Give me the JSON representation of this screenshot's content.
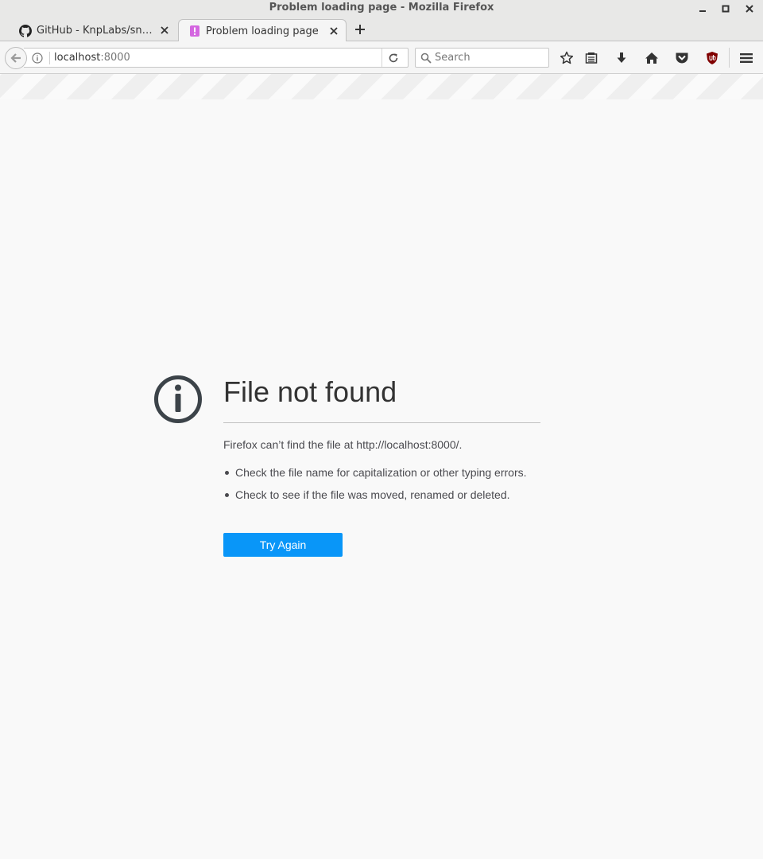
{
  "window": {
    "title": "Problem loading page - Mozilla Firefox",
    "controls": {
      "minimize": "minimize",
      "maximize": "maximize",
      "close": "close"
    }
  },
  "tabs": [
    {
      "label": "GitHub - KnpLabs/snappy",
      "icon": "github-icon",
      "active": false
    },
    {
      "label": "Problem loading page",
      "icon": "warning-page-icon",
      "active": true
    }
  ],
  "navbar": {
    "url_host": "localhost",
    "url_port": ":8000",
    "search_placeholder": "Search"
  },
  "toolbar_icons": [
    "star-icon",
    "reading-list-icon",
    "download-icon",
    "home-icon",
    "pocket-icon",
    "ublock-icon",
    "menu-icon"
  ],
  "error": {
    "title": "File not found",
    "description": "Firefox can’t find the file at http://localhost:8000/.",
    "suggestions": [
      "Check the file name for capitalization or other typing errors.",
      "Check to see if the file was moved, renamed or deleted."
    ],
    "button_label": "Try Again"
  },
  "colors": {
    "accent": "#0996f8",
    "icon_dark": "#3c4349",
    "ublock": "#800000"
  }
}
